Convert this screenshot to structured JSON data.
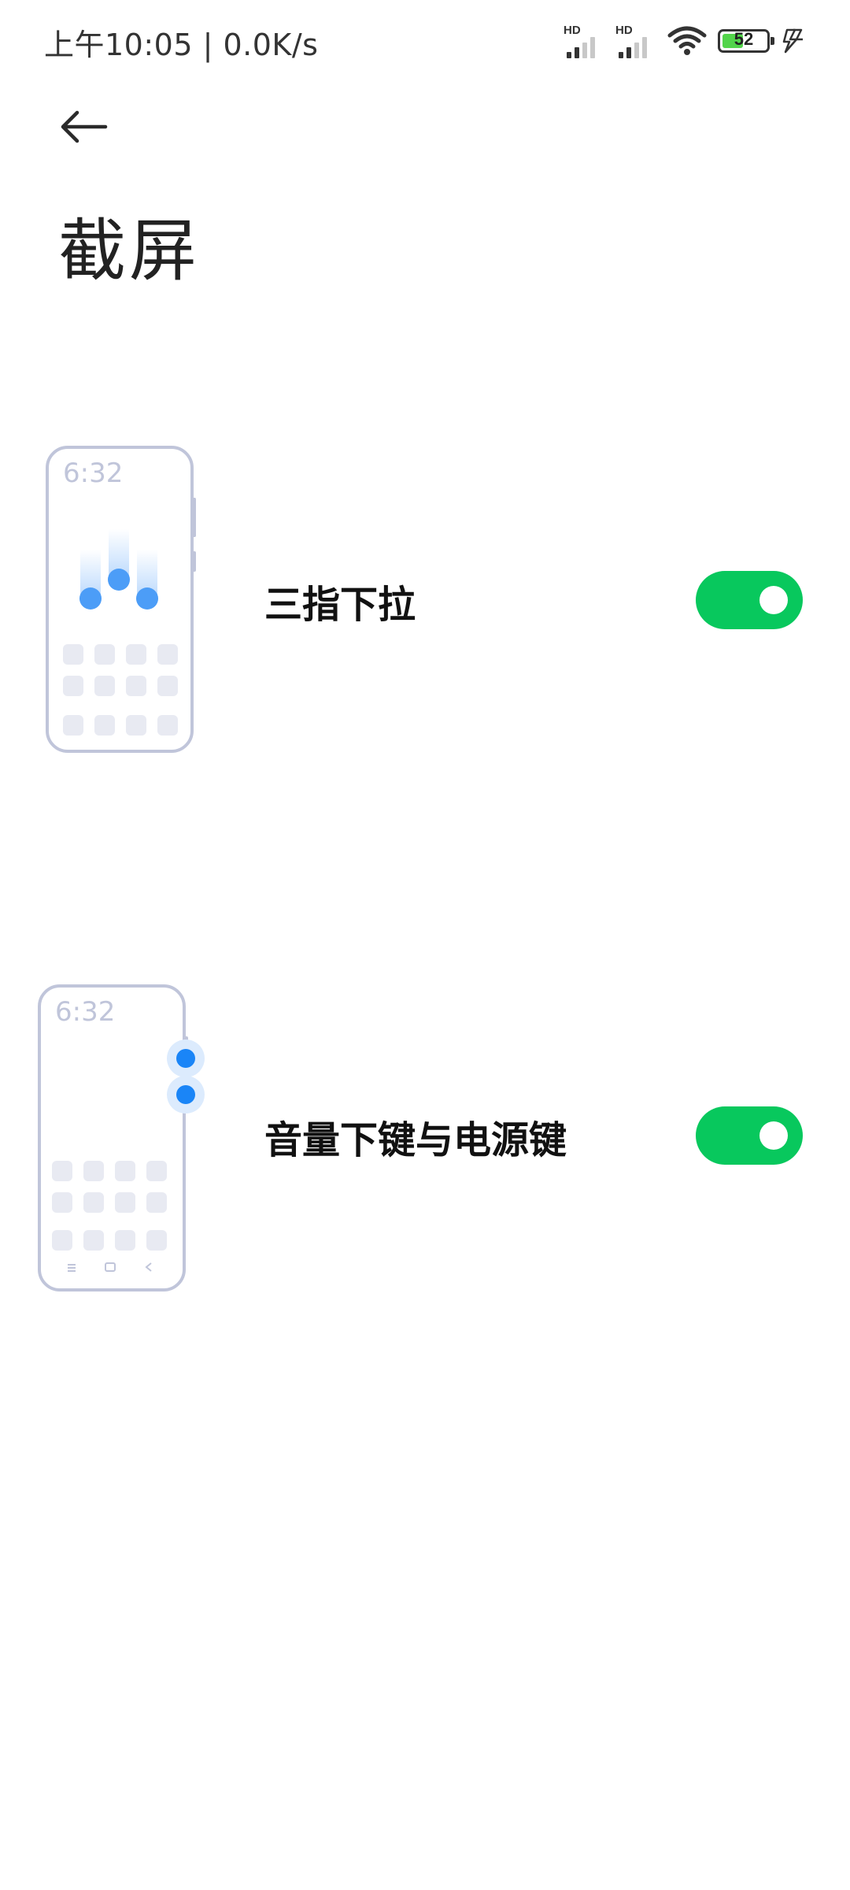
{
  "status_bar": {
    "time_speed": "上午10:05 | 0.0K/s",
    "sim1_label": "HD",
    "sim2_label": "HD",
    "battery_level": "52",
    "battery_color": "#52d44a"
  },
  "header": {
    "title": "截屏"
  },
  "settings": [
    {
      "label": "三指下拉",
      "enabled": true,
      "illustration_time": "6:32"
    },
    {
      "label": "音量下键与电源键",
      "enabled": true,
      "illustration_time": "6:32"
    }
  ],
  "colors": {
    "toggle_on": "#08c85d",
    "accent_blue": "#1a85f7",
    "illustration_outline": "#c0c5da",
    "illustration_tile": "#e8eaf2"
  }
}
